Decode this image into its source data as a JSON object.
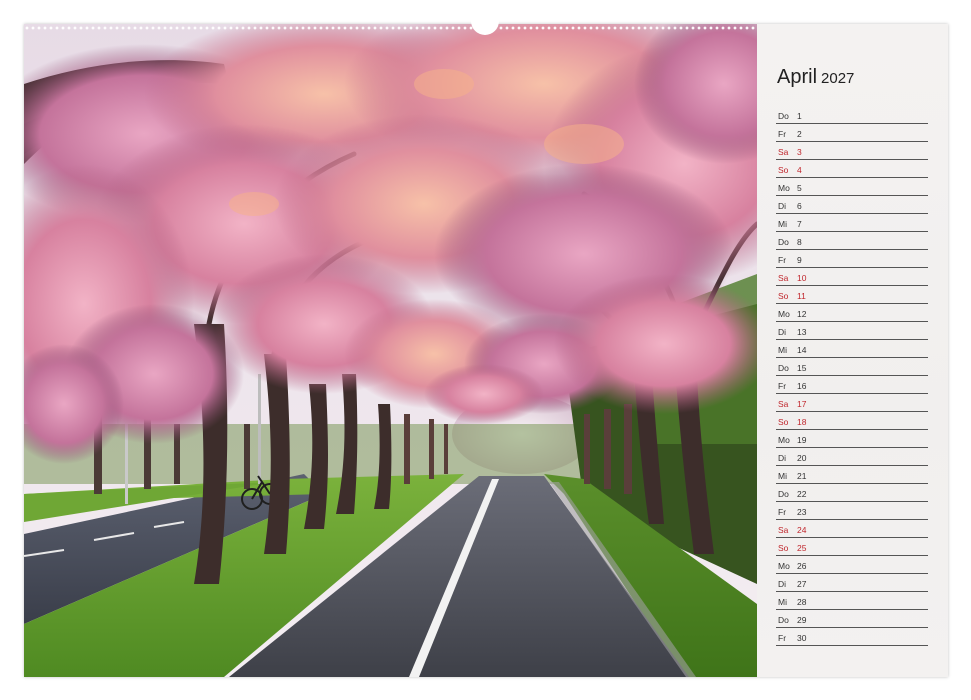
{
  "calendar": {
    "month": "April",
    "year": "2027",
    "days": [
      {
        "wd": "Do",
        "d": "1",
        "weekend": false
      },
      {
        "wd": "Fr",
        "d": "2",
        "weekend": false
      },
      {
        "wd": "Sa",
        "d": "3",
        "weekend": true
      },
      {
        "wd": "So",
        "d": "4",
        "weekend": true
      },
      {
        "wd": "Mo",
        "d": "5",
        "weekend": false
      },
      {
        "wd": "Di",
        "d": "6",
        "weekend": false
      },
      {
        "wd": "Mi",
        "d": "7",
        "weekend": false
      },
      {
        "wd": "Do",
        "d": "8",
        "weekend": false
      },
      {
        "wd": "Fr",
        "d": "9",
        "weekend": false
      },
      {
        "wd": "Sa",
        "d": "10",
        "weekend": true
      },
      {
        "wd": "So",
        "d": "11",
        "weekend": true
      },
      {
        "wd": "Mo",
        "d": "12",
        "weekend": false
      },
      {
        "wd": "Di",
        "d": "13",
        "weekend": false
      },
      {
        "wd": "Mi",
        "d": "14",
        "weekend": false
      },
      {
        "wd": "Do",
        "d": "15",
        "weekend": false
      },
      {
        "wd": "Fr",
        "d": "16",
        "weekend": false
      },
      {
        "wd": "Sa",
        "d": "17",
        "weekend": true
      },
      {
        "wd": "So",
        "d": "18",
        "weekend": true
      },
      {
        "wd": "Mo",
        "d": "19",
        "weekend": false
      },
      {
        "wd": "Di",
        "d": "20",
        "weekend": false
      },
      {
        "wd": "Mi",
        "d": "21",
        "weekend": false
      },
      {
        "wd": "Do",
        "d": "22",
        "weekend": false
      },
      {
        "wd": "Fr",
        "d": "23",
        "weekend": false
      },
      {
        "wd": "Sa",
        "d": "24",
        "weekend": true
      },
      {
        "wd": "So",
        "d": "25",
        "weekend": true
      },
      {
        "wd": "Mo",
        "d": "26",
        "weekend": false
      },
      {
        "wd": "Di",
        "d": "27",
        "weekend": false
      },
      {
        "wd": "Mi",
        "d": "28",
        "weekend": false
      },
      {
        "wd": "Do",
        "d": "29",
        "weekend": false
      },
      {
        "wd": "Fr",
        "d": "30",
        "weekend": false
      }
    ]
  },
  "colors": {
    "weekend": "#c0272d",
    "weekday": "#333333",
    "blossom": "#d98aa8",
    "grass": "#5f9a2e",
    "path": "#4a4d55"
  },
  "photo": {
    "subject": "cherry-blossom-avenue-photo"
  }
}
